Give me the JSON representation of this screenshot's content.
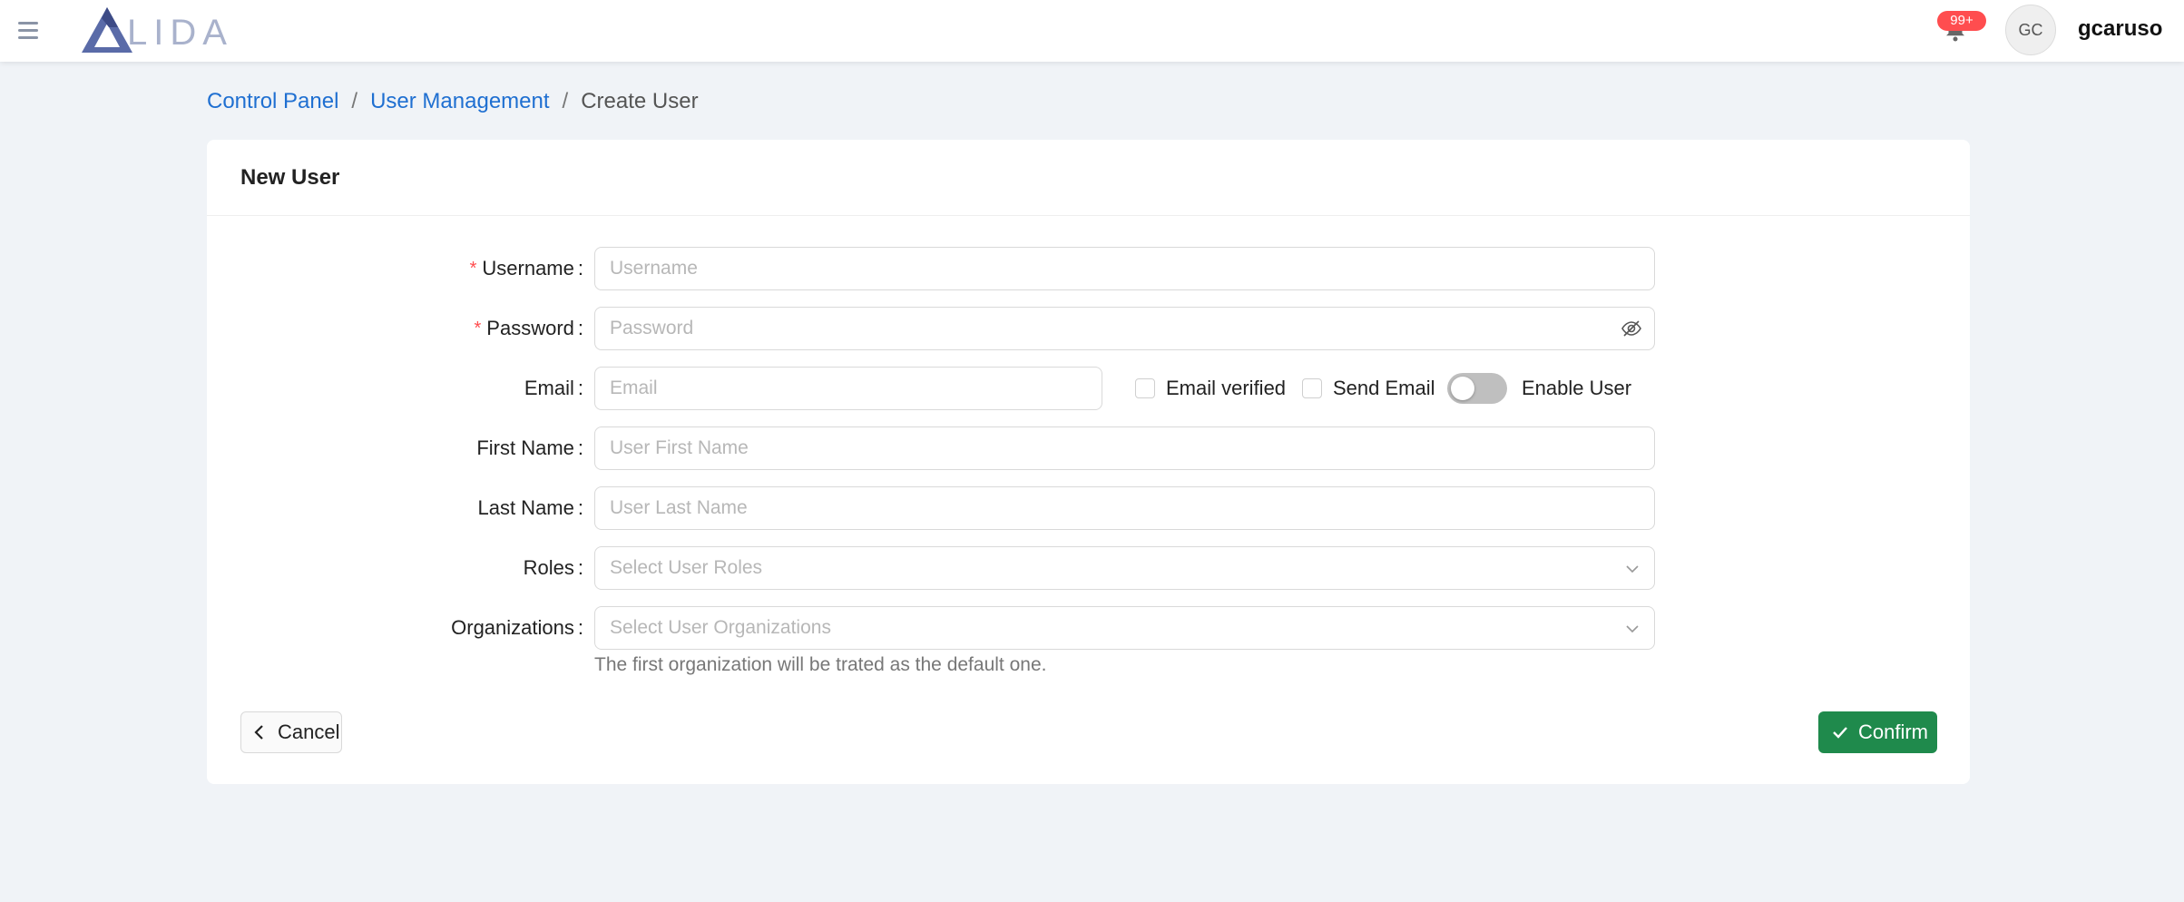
{
  "header": {
    "logo_text": "LIDA",
    "notification_badge": "99+",
    "avatar_initials": "GC",
    "username": "gcaruso"
  },
  "breadcrumb": {
    "items": [
      "Control Panel",
      "User Management",
      "Create User"
    ],
    "separator": "/"
  },
  "card": {
    "title": "New User"
  },
  "form": {
    "username": {
      "label": "Username",
      "placeholder": "Username",
      "required": true
    },
    "password": {
      "label": "Password",
      "placeholder": "Password",
      "required": true
    },
    "email": {
      "label": "Email",
      "placeholder": "Email"
    },
    "email_verified": {
      "label": "Email verified",
      "checked": false
    },
    "send_email": {
      "label": "Send Email",
      "checked": false
    },
    "enable_user": {
      "label": "Enable User",
      "on": false
    },
    "first_name": {
      "label": "First Name",
      "placeholder": "User First Name"
    },
    "last_name": {
      "label": "Last Name",
      "placeholder": "User Last Name"
    },
    "roles": {
      "label": "Roles",
      "placeholder": "Select User Roles"
    },
    "organizations": {
      "label": "Organizations",
      "placeholder": "Select User Organizations"
    },
    "organizations_help": "The first organization will be trated as the default one.",
    "required_marker": "*",
    "colon": ":"
  },
  "actions": {
    "cancel_label": "Cancel",
    "confirm_label": "Confirm"
  },
  "colors": {
    "primary_link": "#1f6fd1",
    "confirm": "#1f8a4c",
    "badge": "#ff4d4f",
    "background": "#f0f3f7"
  }
}
